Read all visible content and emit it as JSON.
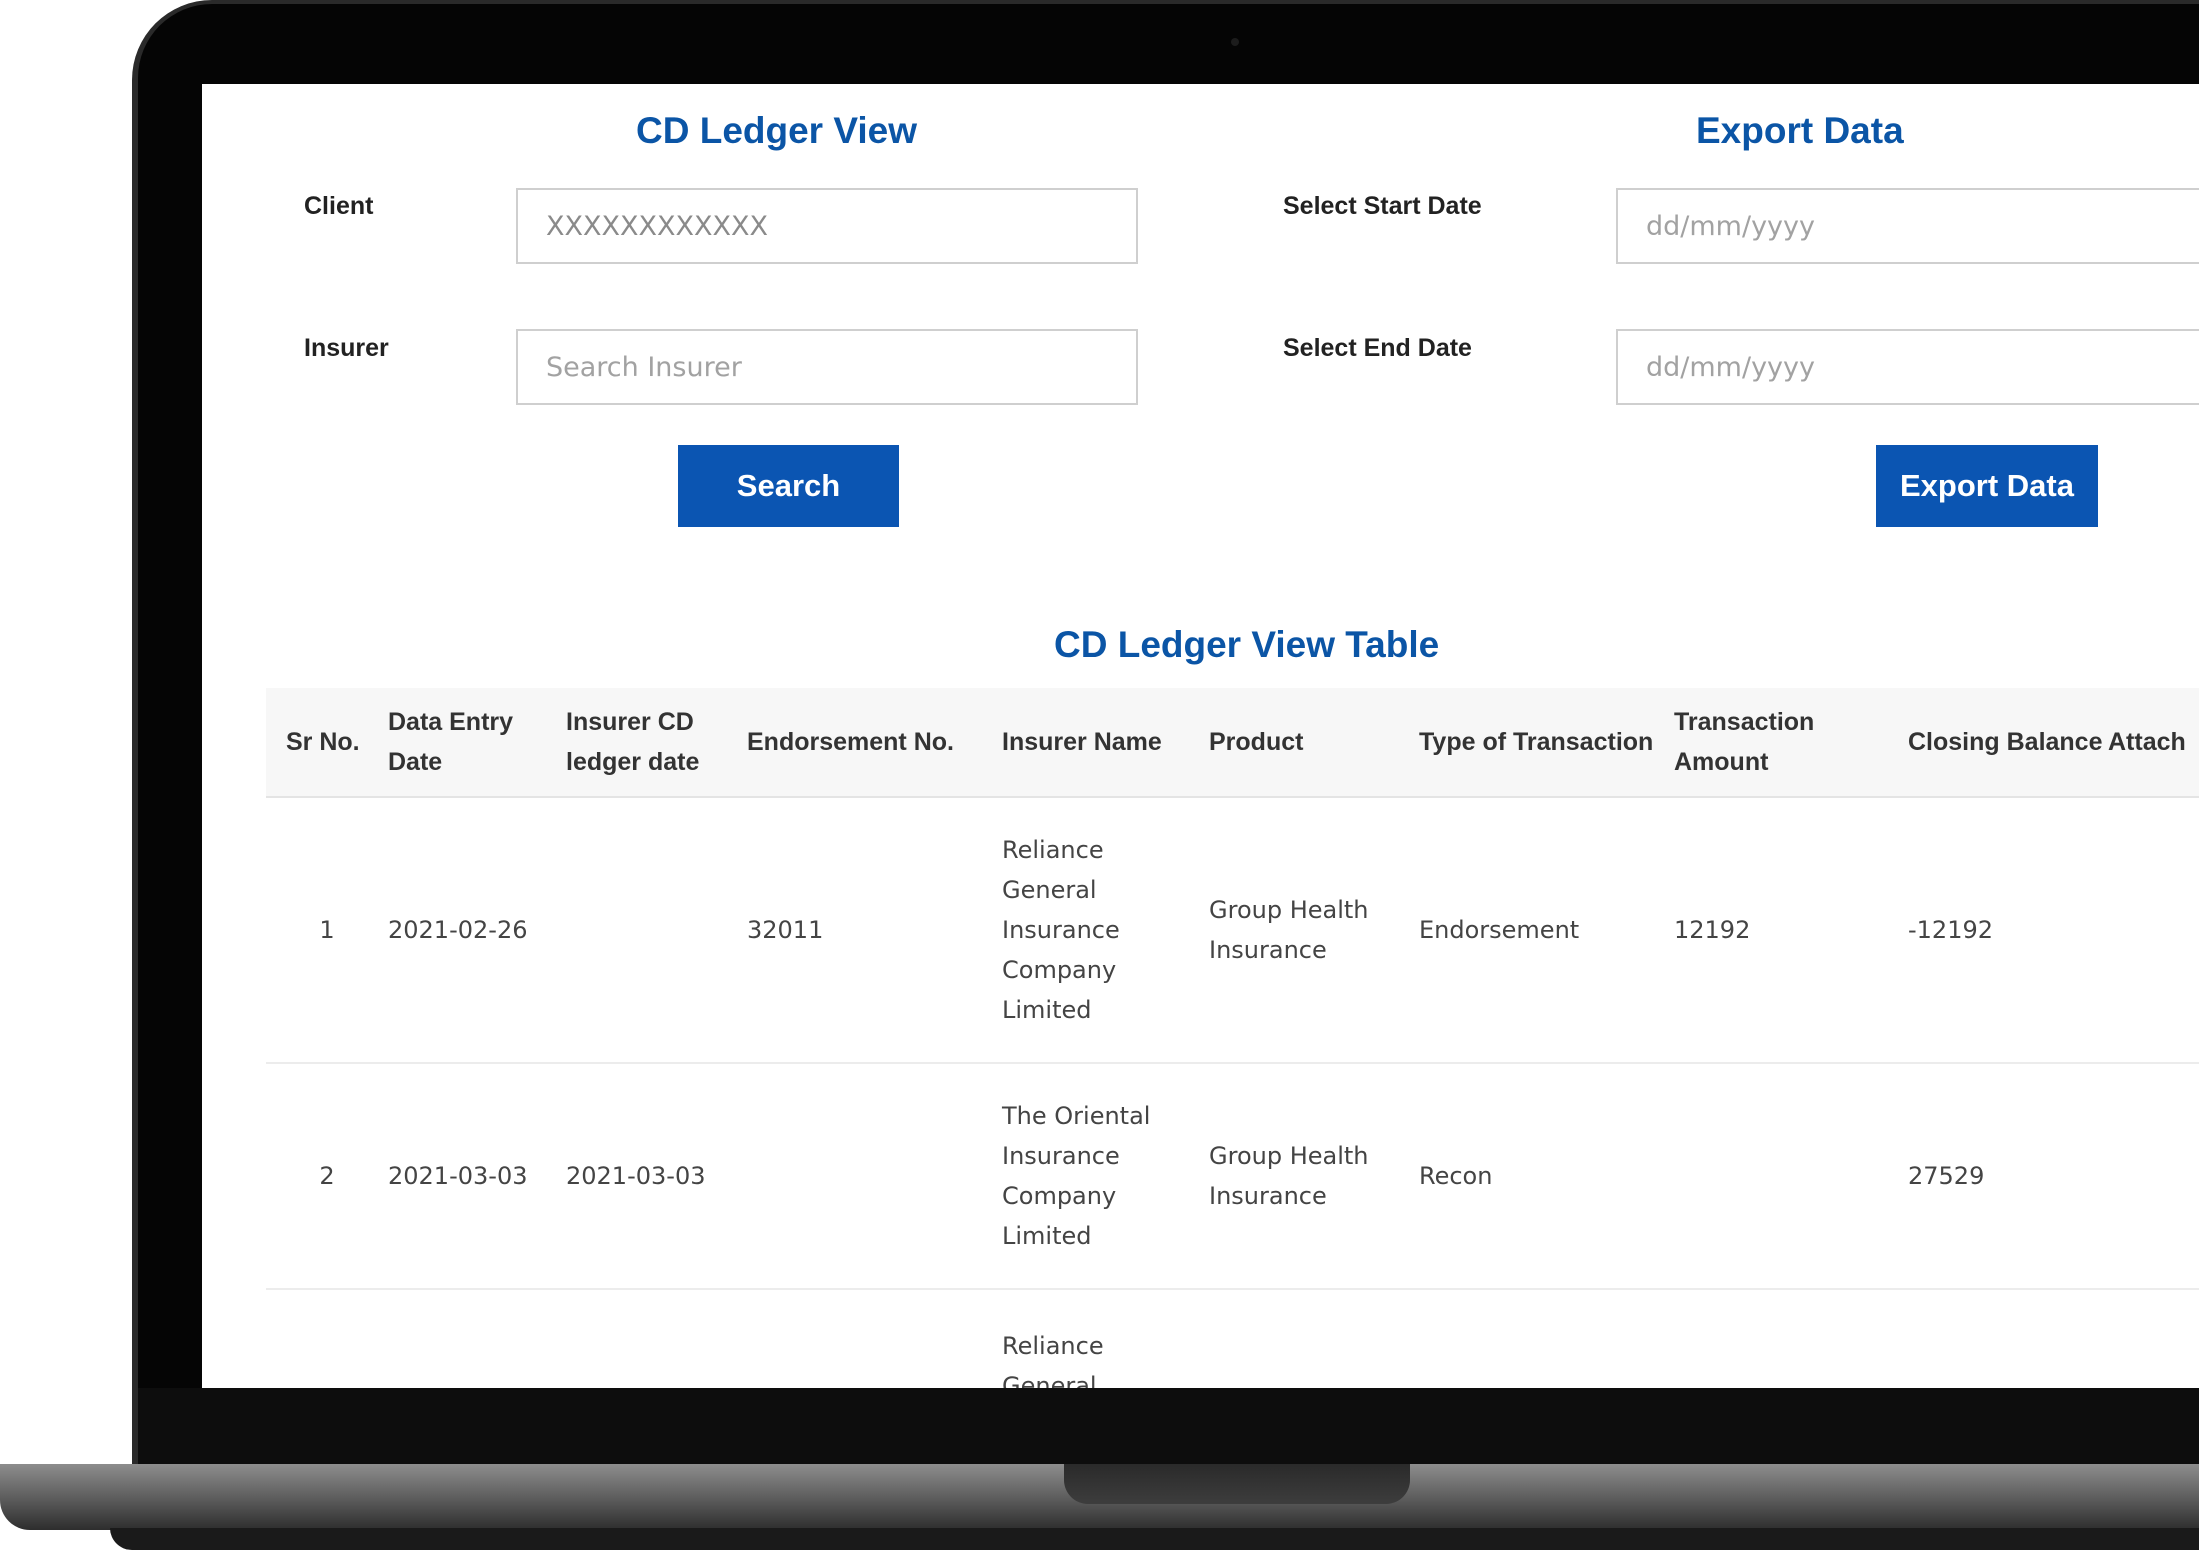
{
  "left_panel": {
    "title": "CD Ledger View",
    "client_label": "Client",
    "client_value": "XXXXXXXXXXXX",
    "insurer_label": "Insurer",
    "insurer_placeholder": "Search Insurer",
    "search_button": "Search"
  },
  "right_panel": {
    "title": "Export Data",
    "start_label": "Select Start Date",
    "start_placeholder": "dd/mm/yyyy",
    "end_label": "Select End Date",
    "end_placeholder": "dd/mm/yyyy",
    "export_button": "Export Data"
  },
  "table": {
    "title": "CD Ledger View Table",
    "headers": [
      "Sr No.",
      "Data Entry Date",
      "Insurer CD ledger date",
      "Endorsement No.",
      "Insurer Name",
      "Product",
      "Type of Transaction",
      "Transaction Amount",
      "Closing Balance",
      "Attach"
    ],
    "rows": [
      [
        "1",
        "2021-02-26",
        "",
        "32011",
        "Reliance General Insurance Company Limited",
        "Group Health Insurance",
        "Endorsement",
        "12192",
        "-12192",
        ""
      ],
      [
        "2",
        "2021-03-03",
        "2021-03-03",
        "",
        "The Oriental Insurance Company Limited",
        "Group Health Insurance",
        "Recon",
        "",
        "27529",
        ""
      ],
      [
        "",
        "",
        "",
        "",
        "Reliance General",
        "",
        "",
        "",
        "",
        ""
      ]
    ]
  },
  "colors": {
    "accent": "#0b55a6",
    "button": "#0b55b2"
  }
}
